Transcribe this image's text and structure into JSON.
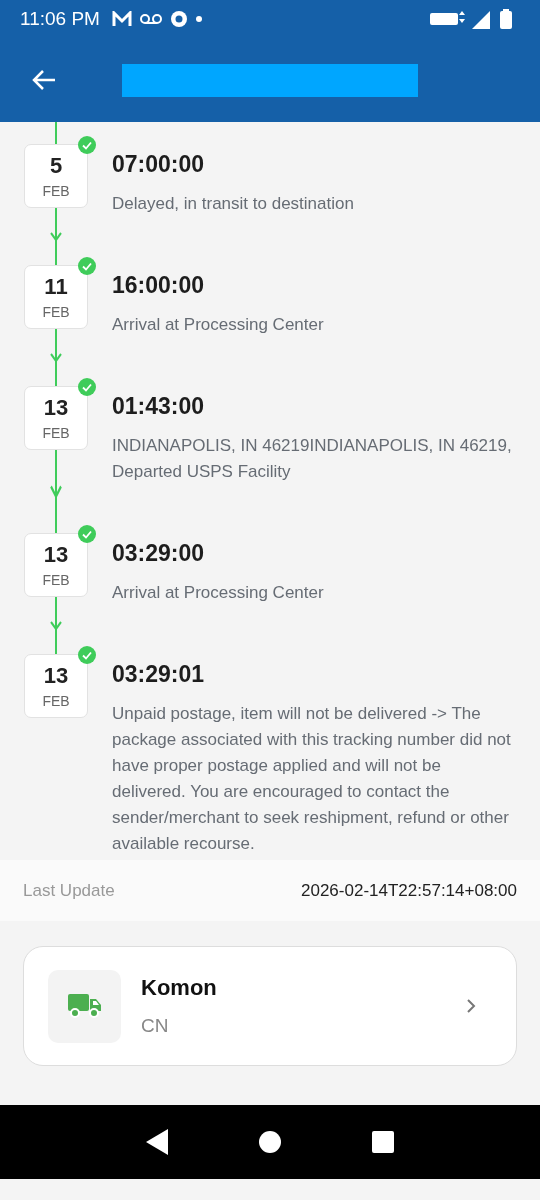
{
  "status_bar": {
    "time": "11:06 PM"
  },
  "events": [
    {
      "day": "5",
      "month": "FEB",
      "time": "07:00:00",
      "description": "Delayed, in transit to destination",
      "done": true
    },
    {
      "day": "11",
      "month": "FEB",
      "time": "16:00:00",
      "description": "Arrival at Processing Center",
      "done": true
    },
    {
      "day": "13",
      "month": "FEB",
      "time": "01:43:00",
      "description": "INDIANAPOLIS, IN 46219INDIANAPOLIS, IN 46219, Departed USPS Facility",
      "done": true
    },
    {
      "day": "13",
      "month": "FEB",
      "time": "03:29:00",
      "description": "Arrival at Processing Center",
      "done": true
    },
    {
      "day": "13",
      "month": "FEB",
      "time": "03:29:01",
      "description": "Unpaid postage, item will not be delivered -> The package associated with this tracking number did not have proper postage applied and will not be delivered. You are encouraged to contact the sender/merchant to seek reshipment, refund or other available recourse.",
      "done": true
    }
  ],
  "last_update": {
    "label": "Last Update",
    "value": "2026-02-14T22:57:14+08:00"
  },
  "carrier": {
    "name": "Komon",
    "country": "CN"
  }
}
